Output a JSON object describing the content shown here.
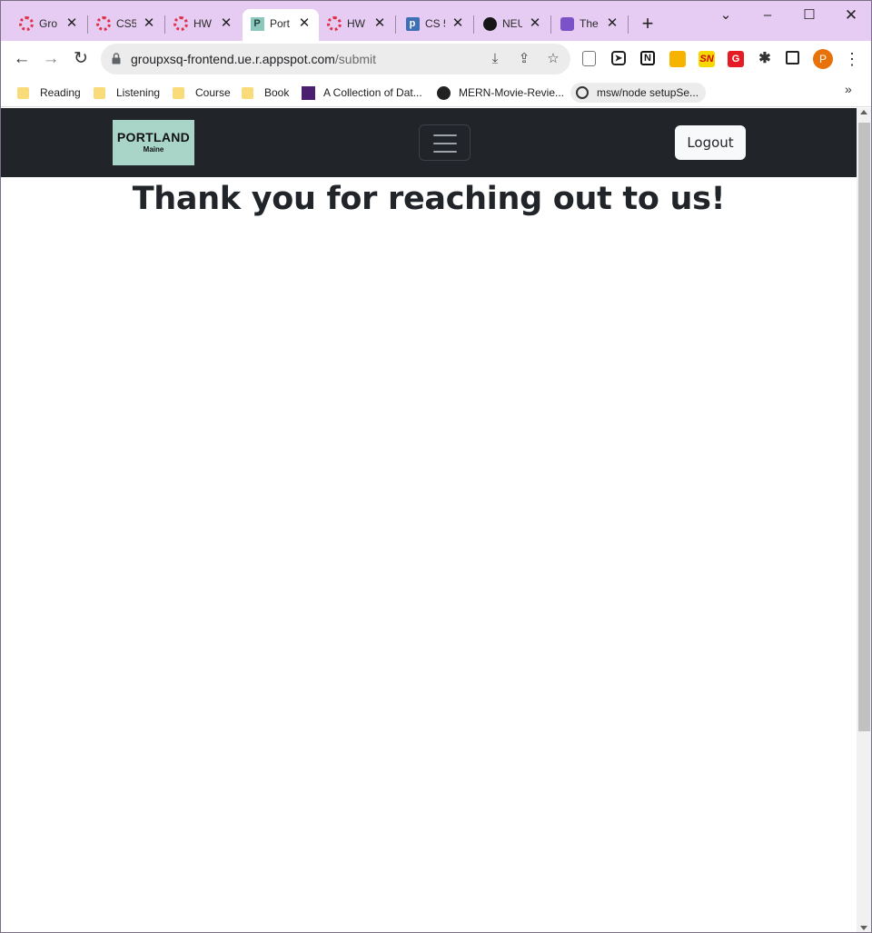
{
  "tabs": [
    {
      "title": "Gro",
      "favicon": "dotted-ring-icon"
    },
    {
      "title": "CS5",
      "favicon": "dotted-ring-icon"
    },
    {
      "title": "HW",
      "favicon": "dotted-ring-icon"
    },
    {
      "title": "Port",
      "favicon": "portland-p-icon",
      "active": true
    },
    {
      "title": "HW",
      "favicon": "dotted-ring-icon"
    },
    {
      "title": "CS 5",
      "favicon": "p-square-icon"
    },
    {
      "title": "NEU",
      "favicon": "github-icon"
    },
    {
      "title": "The",
      "favicon": "rocket-icon"
    }
  ],
  "address_bar": {
    "domain": "groupxsq-frontend.ue.r.appspot.com",
    "path": "/submit"
  },
  "extensions": [
    {
      "name": "page-icon"
    },
    {
      "name": "telegram-icon"
    },
    {
      "name": "notion-icon",
      "glyph": "N"
    },
    {
      "name": "keep-icon",
      "color": "#f6b400"
    },
    {
      "name": "sn-icon",
      "glyph": "SN",
      "color": "#f7d800"
    },
    {
      "name": "grammarly-icon",
      "glyph": "G",
      "color": "#e51c23"
    },
    {
      "name": "puzzle-icon"
    },
    {
      "name": "sidepanel-icon"
    }
  ],
  "profile_initial": "P",
  "bookmarks": [
    {
      "label": "Reading",
      "icon": "folder-icon"
    },
    {
      "label": "Listening",
      "icon": "folder-icon"
    },
    {
      "label": "Course",
      "icon": "folder-icon"
    },
    {
      "label": "Book",
      "icon": "folder-icon"
    },
    {
      "label": "A Collection of Dat...",
      "icon": "flag-icon"
    },
    {
      "label": "MERN-Movie-Revie...",
      "icon": "github-icon"
    },
    {
      "label": "msw/node setupSe...",
      "icon": "globe-icon"
    }
  ],
  "navbar": {
    "brand_line1": "PORTLAND",
    "brand_line2": "Maine",
    "logout_label": "Logout"
  },
  "page": {
    "heading": "Thank you for reaching out to us!"
  },
  "colors": {
    "tabstrip": "#e6ccf2",
    "navbar": "#212529",
    "brand_bg": "#a8d5c8"
  }
}
